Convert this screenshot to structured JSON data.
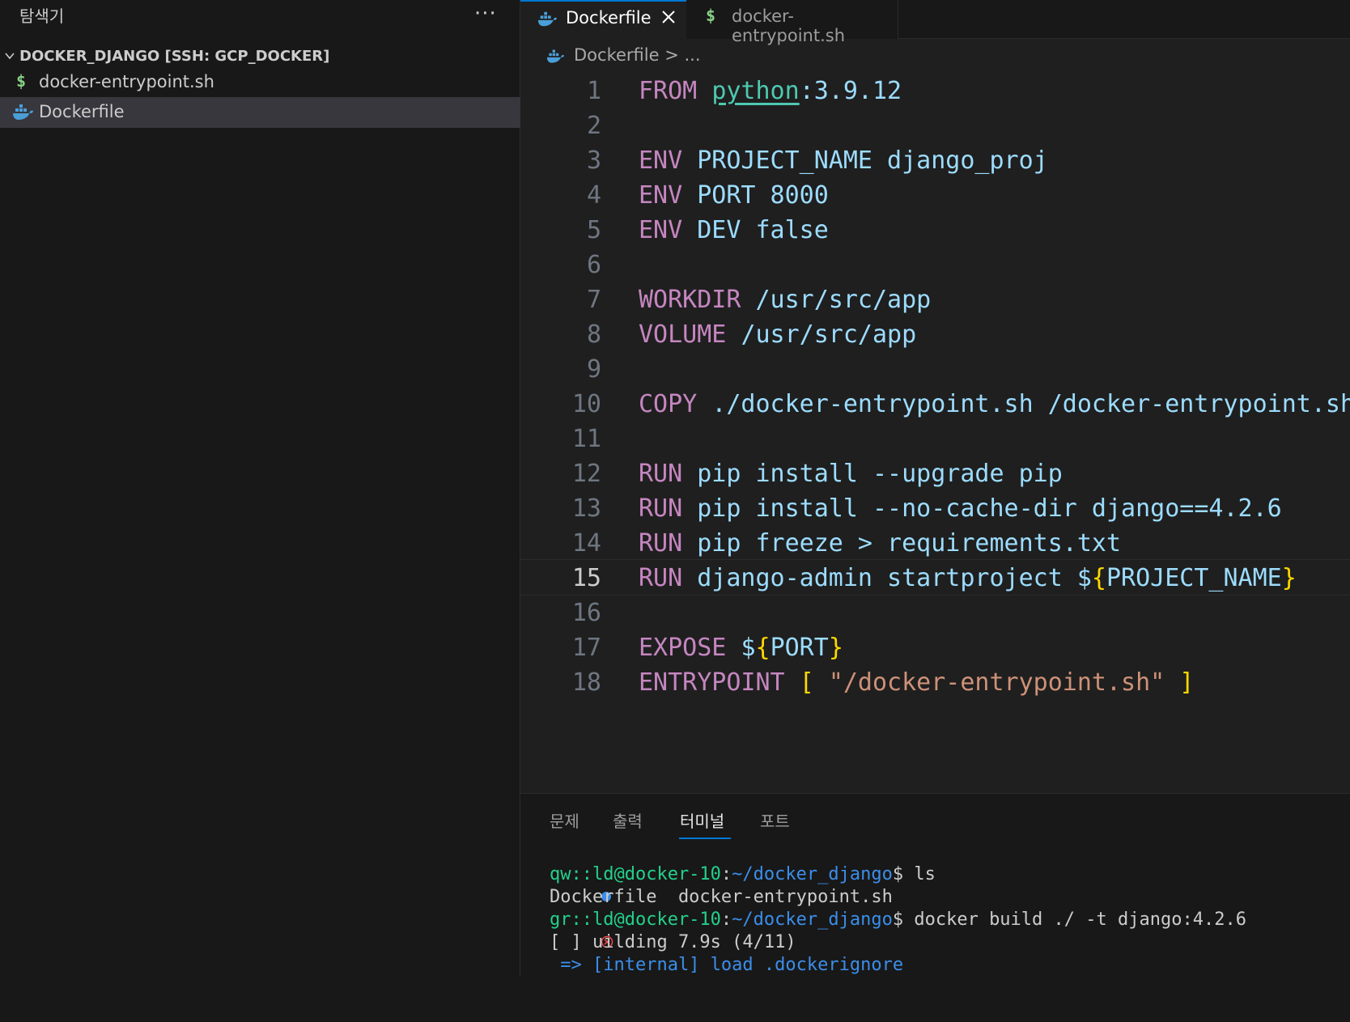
{
  "sidebar": {
    "title": "탐색기",
    "more": "···",
    "section_title": "DOCKER_DJANGO [SSH: GCP_DOCKER]",
    "files": [
      {
        "name": "docker-entrypoint.sh",
        "icon": "$"
      },
      {
        "name": "Dockerfile",
        "icon": "docker-whale-icon"
      }
    ]
  },
  "tabs": [
    {
      "label": "Dockerfile",
      "active": true
    },
    {
      "label": "docker-entrypoint.sh",
      "icon": "$"
    }
  ],
  "breadcrumb": {
    "file": "Dockerfile",
    "rest": "> ..."
  },
  "code": {
    "current_line": 15,
    "lines": [
      {
        "n": "1"
      },
      {
        "n": "2"
      },
      {
        "n": "3"
      },
      {
        "n": "4"
      },
      {
        "n": "5"
      },
      {
        "n": "6"
      },
      {
        "n": "7"
      },
      {
        "n": "8"
      },
      {
        "n": "9"
      },
      {
        "n": "10"
      },
      {
        "n": "11"
      },
      {
        "n": "12"
      },
      {
        "n": "13"
      },
      {
        "n": "14"
      },
      {
        "n": "15"
      },
      {
        "n": "16"
      },
      {
        "n": "17"
      },
      {
        "n": "18"
      }
    ],
    "tokens": {
      "l1": {
        "kw": "FROM",
        "img": "python",
        "rest": ":3.9.12"
      },
      "l3": {
        "kw": "ENV",
        "rest": "PROJECT_NAME django_proj"
      },
      "l4": {
        "kw": "ENV",
        "rest": "PORT 8000"
      },
      "l5": {
        "kw": "ENV",
        "rest": "DEV false"
      },
      "l7": {
        "kw": "WORKDIR",
        "rest": "/usr/src/app"
      },
      "l8": {
        "kw": "VOLUME",
        "rest": "/usr/src/app"
      },
      "l10": {
        "kw": "COPY",
        "rest": "./docker-entrypoint.sh /docker-entrypoint.sh"
      },
      "l12": {
        "kw": "RUN",
        "rest": "pip install --upgrade pip"
      },
      "l13": {
        "kw": "RUN",
        "rest": "pip install --no-cache-dir django==4.2.6"
      },
      "l14": {
        "kw": "RUN",
        "rest": "pip freeze > requirements.txt"
      },
      "l15": {
        "kw": "RUN",
        "rest": "django-admin startproject $",
        "open": "{",
        "var": "PROJECT_NAME",
        "close": "}"
      },
      "l17": {
        "kw": "EXPOSE",
        "rest": "$",
        "open": "{",
        "var": "PORT",
        "close": "}"
      },
      "l18": {
        "kw": "ENTRYPOINT",
        "open": "[",
        "str": "\"/docker-entrypoint.sh\"",
        "close": "]"
      }
    }
  },
  "panel": {
    "tabs": [
      "문제",
      "출력",
      "터미널",
      "포트"
    ],
    "active_tab": "터미널"
  },
  "terminal": {
    "lines": [
      {
        "user": "qw::ld@docker-10",
        "path": "~/docker_django",
        "cmd": "$ ls"
      },
      {
        "out": "Dockerfile  docker-entrypoint.sh"
      },
      {
        "user": "gr::ld@docker-10",
        "path": "~/docker_django",
        "cmd": "$ docker build ./ -t django:4.2.6"
      },
      {
        "out": "[ ] uilding 7.9s (4/11)"
      },
      {
        "out": " => [internal] load .dockerignore"
      }
    ]
  },
  "colors": {
    "accent": "#0078d4",
    "keyword": "#c586c0",
    "text": "#9cdcfe",
    "string": "#ce9178",
    "bracket": "#ffd700",
    "term_user": "#23d18b",
    "term_path": "#3b8eea"
  }
}
